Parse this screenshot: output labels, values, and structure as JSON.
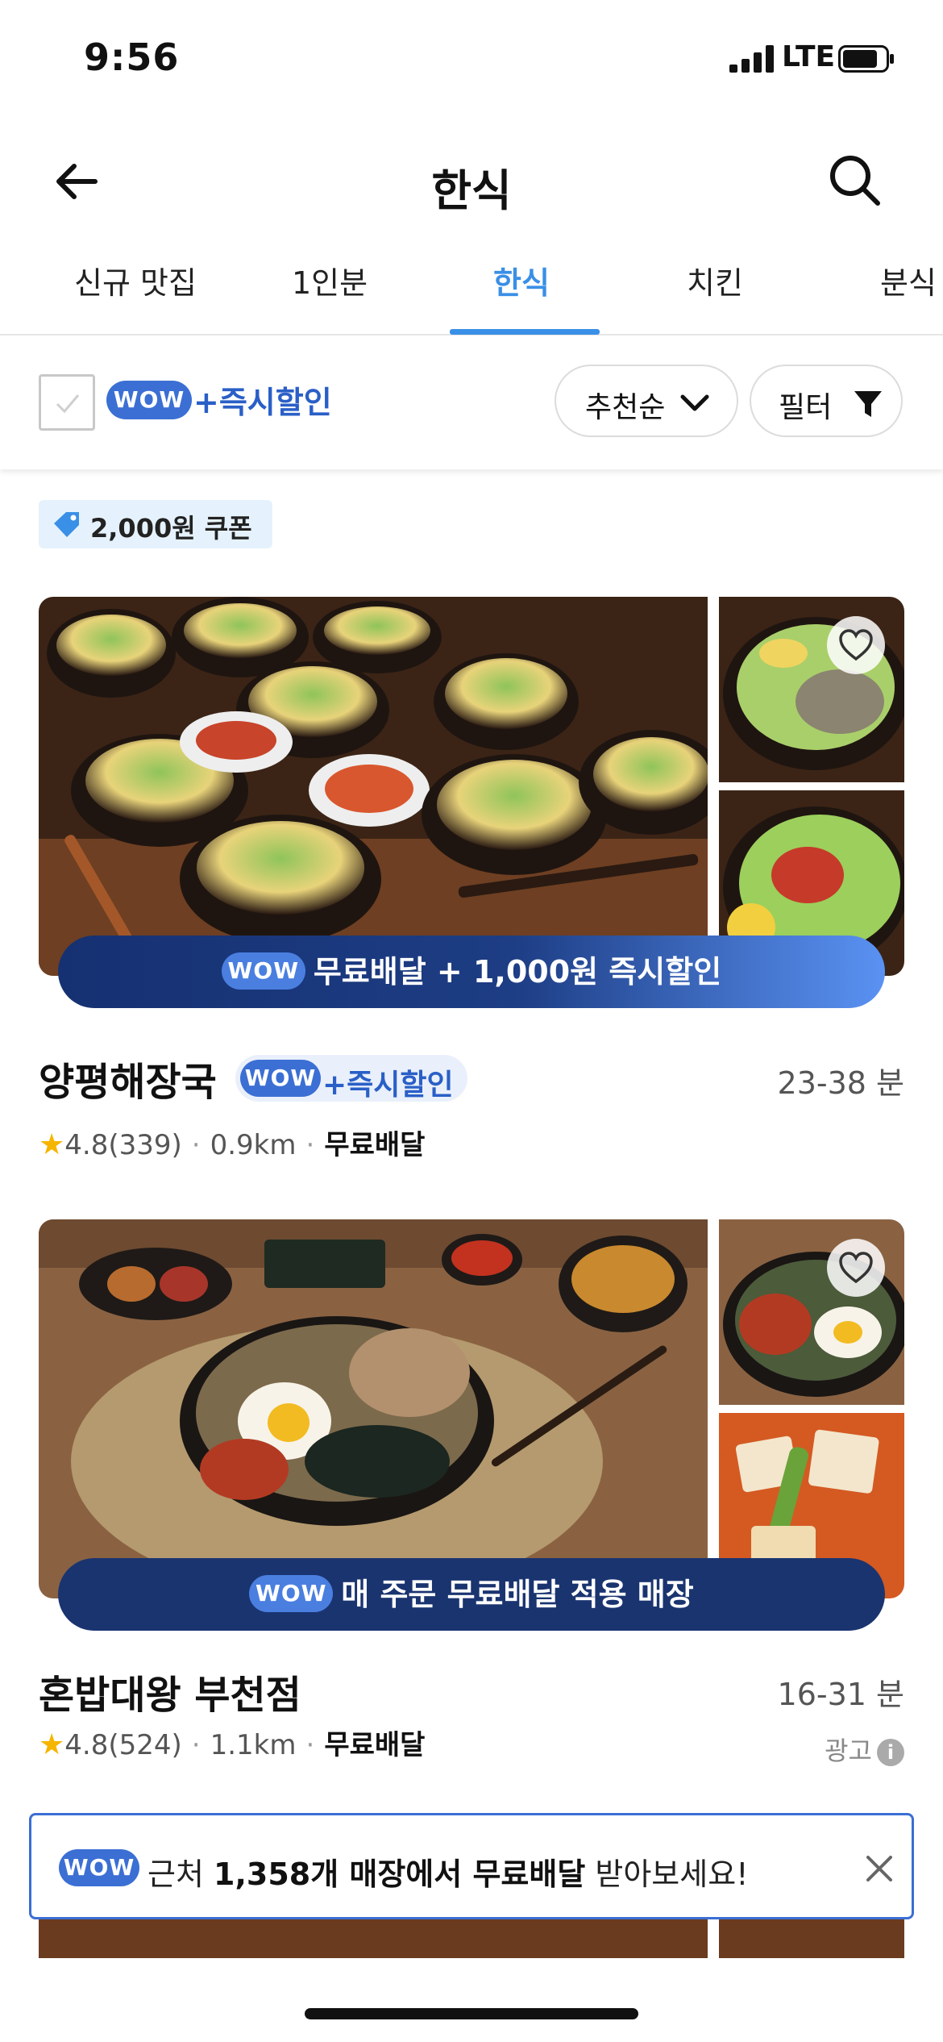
{
  "status_bar": {
    "time": "9:56",
    "network": "LTE"
  },
  "header": {
    "title": "한식"
  },
  "tabs": [
    {
      "label": "신규 맛집"
    },
    {
      "label": "1인분"
    },
    {
      "label": "한식",
      "active": true
    },
    {
      "label": "치킨"
    },
    {
      "label": "분식"
    }
  ],
  "filters": {
    "wow_badge": "WOW",
    "wow_discount_label": "+즉시할인",
    "sort_label": "추천순",
    "filter_label": "필터"
  },
  "coupon": {
    "label": "2,000원 쿠폰"
  },
  "restaurants": [
    {
      "name": "양평해장국",
      "tag_badge": "WOW",
      "tag_label": "+즉시할인",
      "delivery_time": "23-38 분",
      "rating": "4.8",
      "reviews": "(339)",
      "distance": "0.9km",
      "delivery_fee": "무료배달",
      "banner_badge": "WOW",
      "banner_text": "무료배달 + 1,000원 즉시할인"
    },
    {
      "name": "혼밥대왕 부천점",
      "delivery_time": "16-31 분",
      "rating": "4.8",
      "reviews": "(524)",
      "distance": "1.1km",
      "delivery_fee": "무료배달",
      "banner_badge": "WOW",
      "banner_text": "매 주문 무료배달 적용 매장",
      "ad_label": "광고"
    }
  ],
  "promo": {
    "badge": "WOW",
    "text_prefix": "근처 ",
    "text_bold": "1,358개 매장에서 무료배달",
    "text_suffix": " 받아보세요!"
  },
  "colors": {
    "accent": "#3a8fe6",
    "wow_blue": "#3b6fd4",
    "banner_navy": "#1a3470",
    "star": "#f5b500"
  }
}
